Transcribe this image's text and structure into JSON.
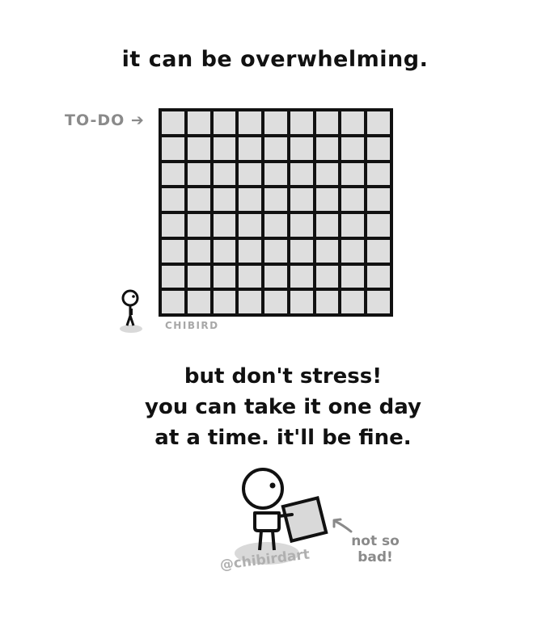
{
  "title": "it can be overwhelming.",
  "todo_label": "TO-DO",
  "grid": {
    "columns": 9,
    "rows": 8
  },
  "watermark": "CHIBIRD",
  "message": {
    "line1": "but don't stress!",
    "line2": "you can take it one day",
    "line3": "at a time. it'll be fine."
  },
  "side_note": {
    "line1": "not so",
    "line2": "bad!"
  },
  "credit": "@chibirdart",
  "icons": [
    "right-arrow-icon",
    "small-person-icon",
    "person-holding-box-icon",
    "left-arrow-icon"
  ]
}
